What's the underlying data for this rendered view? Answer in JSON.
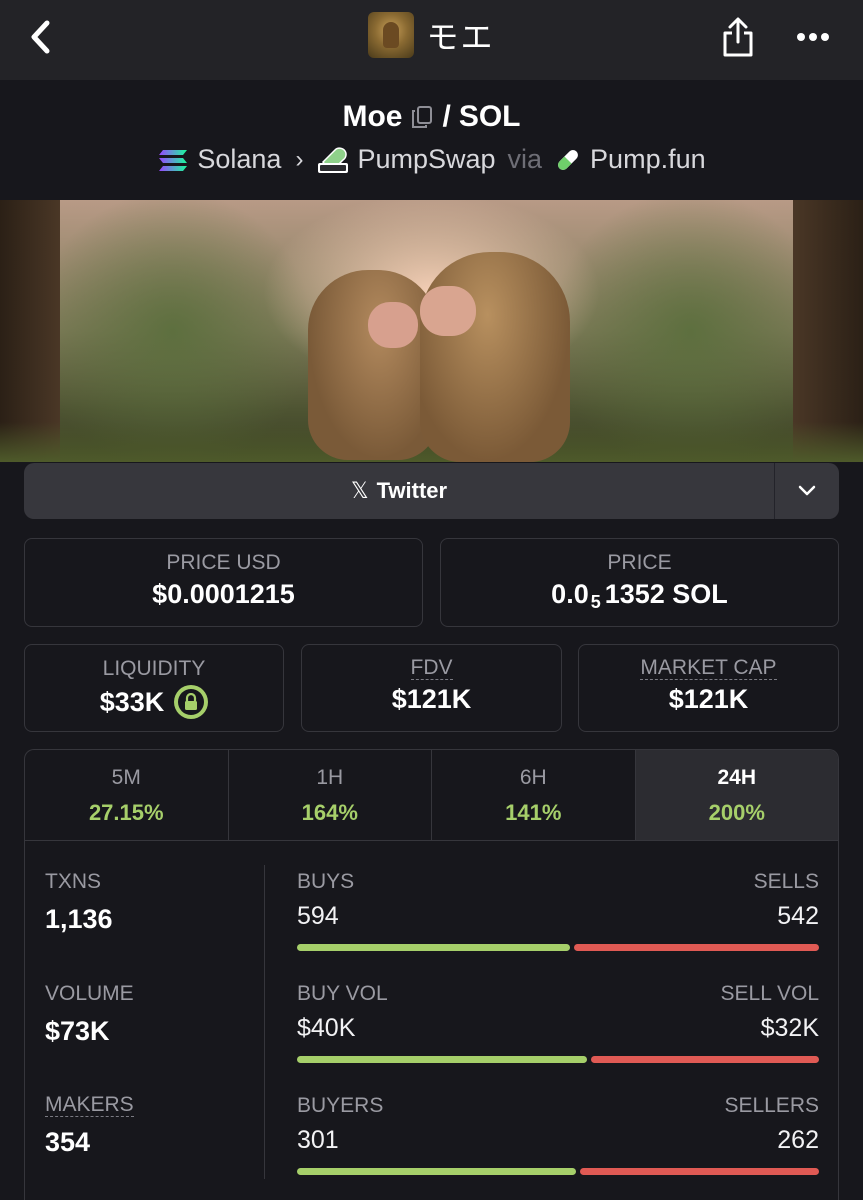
{
  "nav": {
    "title": "モエ",
    "back_icon": "chevron-left-icon",
    "share_icon": "share-icon",
    "more_icon": "more-dots-icon"
  },
  "pair": {
    "base": "Moe",
    "separator": "/",
    "quote": "SOL",
    "chain": "Solana",
    "dex": "PumpSwap",
    "via": "via",
    "launchpad": "Pump.fun"
  },
  "social": {
    "twitter_label": "Twitter"
  },
  "prices": {
    "price_usd_label": "PRICE USD",
    "price_usd": "$0.0001215",
    "price_label": "PRICE",
    "price_prefix": "0.0",
    "price_zeros": "5",
    "price_rest": "1352 SOL"
  },
  "stats": {
    "liquidity_label": "LIQUIDITY",
    "liquidity": "$33K",
    "fdv_label": "FDV",
    "fdv": "$121K",
    "mcap_label": "MARKET CAP",
    "mcap": "$121K"
  },
  "timeframes": [
    {
      "label": "5M",
      "change": "27.15%"
    },
    {
      "label": "1H",
      "change": "164%"
    },
    {
      "label": "6H",
      "change": "141%"
    },
    {
      "label": "24H",
      "change": "200%"
    }
  ],
  "active_timeframe": "24H",
  "metrics": {
    "txns_label": "TXNS",
    "txns": "1,136",
    "volume_label": "VOLUME",
    "volume": "$73K",
    "makers_label": "MAKERS",
    "makers": "354"
  },
  "splits": {
    "buys_label": "BUYS",
    "buys": "594",
    "sells_label": "SELLS",
    "sells": "542",
    "buys_fraction": 0.523,
    "buy_vol_label": "BUY VOL",
    "buy_vol": "$40K",
    "sell_vol_label": "SELL VOL",
    "sell_vol": "$32K",
    "buy_vol_fraction": 0.556,
    "buyers_label": "BUYERS",
    "buyers": "301",
    "sellers_label": "SELLERS",
    "sellers": "262",
    "buyers_fraction": 0.535
  },
  "colors": {
    "positive": "#a6cf6a",
    "negative": "#e05a54",
    "background": "#17171c"
  }
}
